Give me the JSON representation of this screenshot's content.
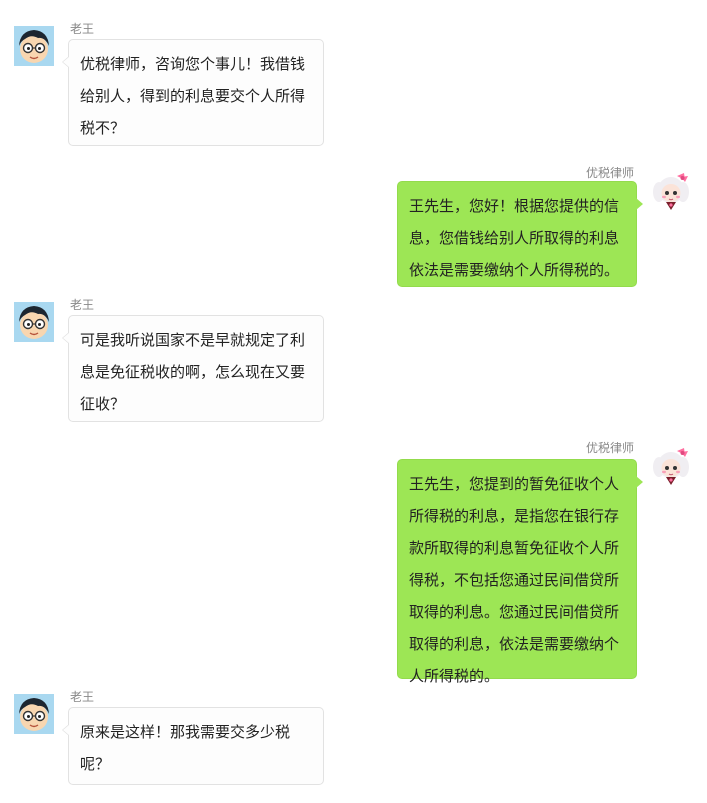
{
  "messages": [
    {
      "sender": "老王",
      "text": "优税律师，咨询您个事儿！我借钱给别人，得到的利息要交个人所得税不？"
    },
    {
      "sender": "优税律师",
      "text": "王先生，您好！根据您提供的信息，您借钱给别人所取得的利息依法是需要缴纳个人所得税的。"
    },
    {
      "sender": "老王",
      "text": "可是我听说国家不是早就规定了利息是免征税收的啊，怎么现在又要征收？"
    },
    {
      "sender": "优税律师",
      "text": "王先生，您提到的暂免征收个人所得税的利息，是指您在银行存款所取得的利息暂免征收个人所得税，不包括您通过民间借贷所取得的利息。您通过民间借贷所取得的利息，依法是需要缴纳个人所得税的。"
    },
    {
      "sender": "老王",
      "text": "原来是这样！那我需要交多少税呢？"
    }
  ],
  "icons": {
    "client_avatar": "boy-with-glasses-avatar-icon",
    "lawyer_avatar": "girl-with-pink-bow-avatar-icon"
  },
  "colors": {
    "lawyer_bubble": "#9de655",
    "client_bubble": "#fdfdfd",
    "client_bubble_border": "#e2e2e2",
    "name_text": "#888888"
  }
}
